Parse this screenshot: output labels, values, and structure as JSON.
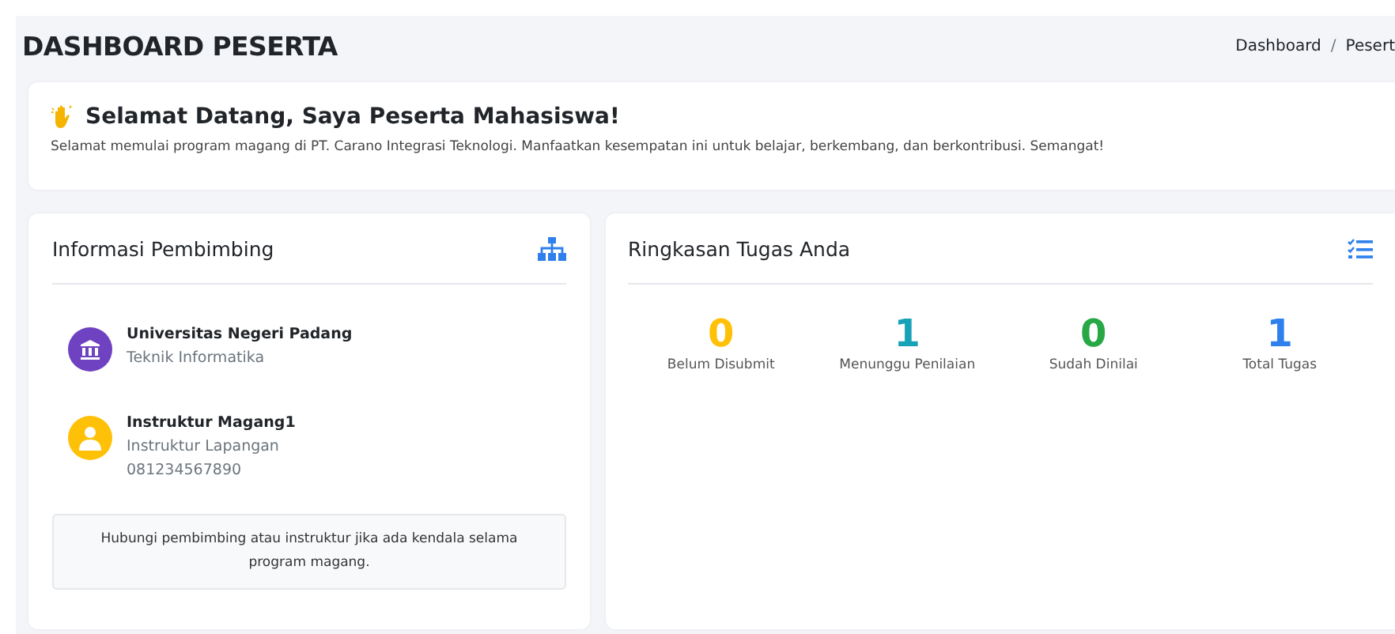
{
  "page_title": "DASHBOARD PESERTA",
  "breadcrumb": {
    "separator": "/",
    "items": [
      "Dashboard",
      "Pesert"
    ]
  },
  "welcome": {
    "title": "Selamat Datang, Saya Peserta Mahasiswa!",
    "message": "Selamat memulai program magang di PT. Carano Integrasi Teknologi. Manfaatkan kesempatan ini untuk belajar, berkembang, dan berkontribusi. Semangat!"
  },
  "mentor_card": {
    "title": "Informasi Pembimbing",
    "contacts": [
      {
        "kind": "university",
        "name": "Universitas Negeri Padang",
        "lines": [
          "Teknik Informatika"
        ],
        "color": "#6f42c1"
      },
      {
        "kind": "person",
        "name": "Instruktur Magang1",
        "lines": [
          "Instruktur Lapangan",
          "081234567890"
        ],
        "color": "#ffc107"
      }
    ],
    "note": "Hubungi pembimbing atau instruktur jika ada kendala selama program magang."
  },
  "task_card": {
    "title": "Ringkasan Tugas Anda",
    "stats": [
      {
        "value": "0",
        "label": "Belum Disubmit",
        "color": "#ffc107"
      },
      {
        "value": "1",
        "label": "Menunggu Penilaian",
        "color": "#17a2b8"
      },
      {
        "value": "0",
        "label": "Sudah Dinilai",
        "color": "#28a745"
      },
      {
        "value": "1",
        "label": "Total Tugas",
        "color": "#2f80ed"
      }
    ]
  }
}
